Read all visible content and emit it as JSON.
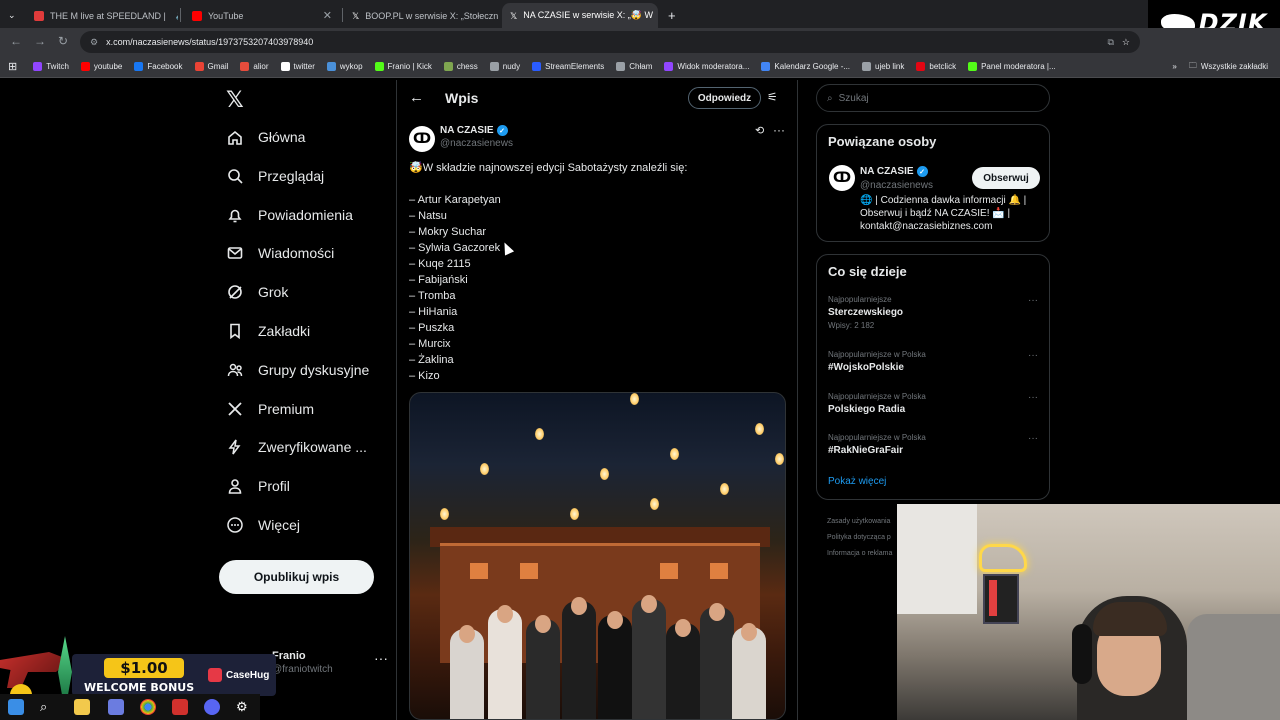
{
  "browser": {
    "tabs": [
      {
        "title": "THE M live at SPEEDLAND |",
        "color": "#e03b3b",
        "active": false
      },
      {
        "title": "YouTube",
        "color": "#ff0000",
        "active": false
      },
      {
        "title": "BOOP.PL w serwisie X: „Stołeczni",
        "color": "#ffffff",
        "active": false
      },
      {
        "title": "NA CZASIE w serwisie X: „🤯 W",
        "color": "#ffffff",
        "active": true
      }
    ],
    "url": "x.com/naczasienews/status/1973753207403978940",
    "bookmarks": [
      "Twitch",
      "youtube",
      "Facebook",
      "Gmail",
      "alior",
      "twitter",
      "wykop",
      "Franio | Kick",
      "chess",
      "nudy",
      "StreamElements",
      "Chłam",
      "Widok moderatora...",
      "Kalendarz Google -...",
      "ujeb link",
      "betclick",
      "Panel moderatora |..."
    ],
    "all_bookmarks": "Wszystkie zakładki"
  },
  "overlay": {
    "brand": "DZIK"
  },
  "nav": {
    "items": [
      {
        "label": "Główna",
        "icon": "home-icon"
      },
      {
        "label": "Przeglądaj",
        "icon": "search-icon"
      },
      {
        "label": "Powiadomienia",
        "icon": "bell-icon"
      },
      {
        "label": "Wiadomości",
        "icon": "mail-icon"
      },
      {
        "label": "Grok",
        "icon": "grok-icon"
      },
      {
        "label": "Zakładki",
        "icon": "bookmark-icon"
      },
      {
        "label": "Grupy dyskusyjne",
        "icon": "community-icon"
      },
      {
        "label": "Premium",
        "icon": "x-icon"
      },
      {
        "label": "Zweryfikowane ...",
        "icon": "lightning-icon"
      },
      {
        "label": "Profil",
        "icon": "person-icon"
      },
      {
        "label": "Więcej",
        "icon": "more-circle-icon"
      }
    ],
    "publish": "Opublikuj wpis",
    "account_name": "Franio",
    "account_handle": "@franiotwitch"
  },
  "post": {
    "header": "Wpis",
    "reply_button": "Odpowiedz",
    "author": "NA CZASIE",
    "handle": "@naczasienews",
    "lead": "🤯W składzie najnowszej edycji Sabotażysty znaleźli się:",
    "list": [
      "– Artur Karapetyan",
      "– Natsu",
      "– Mokry Suchar",
      "– Sylwia Gaczorek",
      "– Kuqe 2115",
      "– Fabijański",
      "– Tromba",
      "– HiHania",
      "– Puszka",
      "– Murcix",
      "– Żaklina",
      "– Kizo"
    ]
  },
  "sidebar": {
    "search_placeholder": "Szukaj",
    "related_title": "Powiązane osoby",
    "related_name": "NA CZASIE",
    "related_handle": "@naczasienews",
    "follow": "Obserwuj",
    "bio": "🌐 | Codzienna dawka informacji 🔔 | Obserwuj i bądź NA CZASIE! 📩 | kontakt@naczasiebiznes.com",
    "trends_title": "Co się dzieje",
    "trends": [
      {
        "category": "Najpopularniejsze",
        "title": "Sterczewskiego",
        "count": "Wpisy: 2 182"
      },
      {
        "category": "Najpopularniejsze w Polska",
        "title": "#WojskoPolskie",
        "count": ""
      },
      {
        "category": "Najpopularniejsze w Polska",
        "title": "Polskiego Radia",
        "count": ""
      },
      {
        "category": "Najpopularniejsze w Polska",
        "title": "#RakNieGraFair",
        "count": ""
      }
    ],
    "show_more": "Pokaż więcej",
    "footer": [
      "Zasady użytkowania",
      "Polityka dotycząca p",
      "Informacja o reklama"
    ]
  },
  "promo": {
    "amount": "$1.00",
    "text": "WELCOME BONUS",
    "brand": "CaseHug"
  }
}
